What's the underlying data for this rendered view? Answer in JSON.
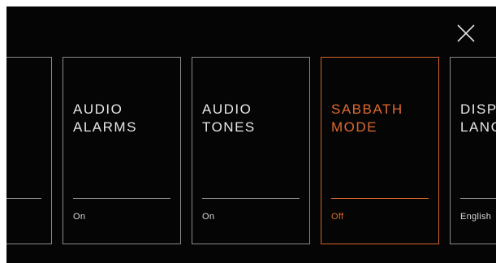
{
  "colors": {
    "background": "#050505",
    "card_border": "#8a8a8a",
    "accent": "#d4622a",
    "text": "#e6e6e6"
  },
  "header": {
    "close_icon": "close-icon"
  },
  "cards": [
    {
      "title": "",
      "value": ""
    },
    {
      "title": "AUDIO\nALARMS",
      "value": "On"
    },
    {
      "title": "AUDIO\nTONES",
      "value": "On"
    },
    {
      "title": "SABBATH\nMODE",
      "value": "Off",
      "selected": true
    },
    {
      "title": "DISP\nLANG",
      "value": "English"
    }
  ]
}
